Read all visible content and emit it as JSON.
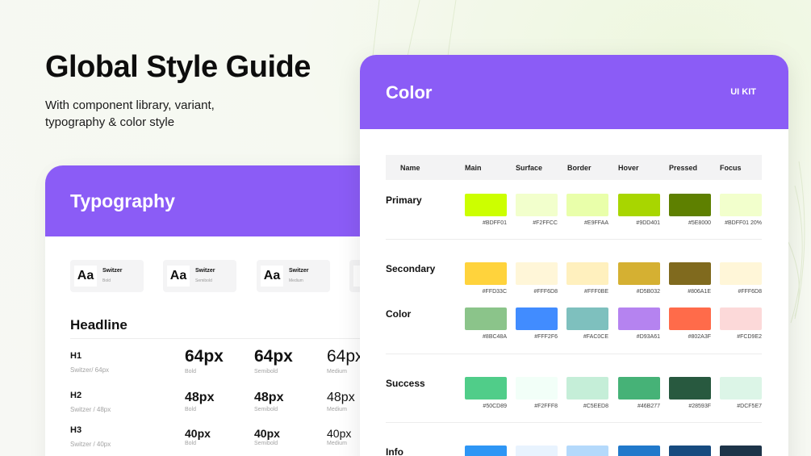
{
  "hero": {
    "title": "Global Style Guide",
    "subtitle": "With component library, variant, typography & color style"
  },
  "typography_card": {
    "title": "Typography",
    "font_chips": [
      {
        "sample": "Aa",
        "name": "Switzer",
        "weight": "Bold"
      },
      {
        "sample": "Aa",
        "name": "Switzer",
        "weight": "Semibold"
      },
      {
        "sample": "Aa",
        "name": "Switzer",
        "weight": "Medium"
      },
      {
        "sample": "A",
        "name": "",
        "weight": ""
      }
    ],
    "section_title": "Headline",
    "rows": [
      {
        "tag": "H1",
        "sub": "Switzer/ 64px",
        "size": "64px",
        "weights": [
          "Bold",
          "Semibold",
          "Medium"
        ]
      },
      {
        "tag": "H2",
        "sub": "Switzer / 48px",
        "size": "48px",
        "weights": [
          "Bold",
          "Semibold",
          "Medium"
        ]
      },
      {
        "tag": "H3",
        "sub": "Switzer / 40px",
        "size": "40px",
        "weights": [
          "Bold",
          "Semibold",
          "Medium"
        ]
      }
    ]
  },
  "color_card": {
    "title": "Color",
    "kit_label": "UI KIT",
    "accent": "#8B5CF6",
    "columns": [
      "Name",
      "Main",
      "Surface",
      "Border",
      "Hover",
      "Pressed",
      "Focus"
    ],
    "rows": [
      {
        "name": "Primary",
        "colors": [
          "#CCFF00",
          "#F2FFCC",
          "#E9FFAA",
          "#A8D600",
          "#5E8000",
          "#F2FFCC"
        ],
        "hex": [
          "#BDFF01",
          "#F2FFCC",
          "#E9FFAA",
          "#9DD401",
          "#5E8000",
          "#BDFF01 20%"
        ]
      },
      {
        "name": "Secondary",
        "colors": [
          "#FFD33C",
          "#FFF6D8",
          "#FFF0BE",
          "#D5B032",
          "#806A1E",
          "#FFF6D8"
        ],
        "hex": [
          "#FFD33C",
          "#FFF6D8",
          "#FFF0BE",
          "#D5B032",
          "#806A1E",
          "#FFF6D8"
        ]
      },
      {
        "name": "Color",
        "colors": [
          "#8BC48A",
          "#418CFF",
          "#7EC0BE",
          "#B583F0",
          "#FF6B4A",
          "#FCD9D9"
        ],
        "hex": [
          "#8BC48A",
          "#FFF2F6",
          "#FAC0CE",
          "#D93A61",
          "#802A3F",
          "#FCD9E2"
        ]
      },
      {
        "name": "Success",
        "colors": [
          "#50CD89",
          "#F2FFF8",
          "#C5EED8",
          "#46B277",
          "#28593F",
          "#DCF5E7"
        ],
        "hex": [
          "#50CD89",
          "#F2FFF8",
          "#C5EED8",
          "#46B277",
          "#28593F",
          "#DCF5E7"
        ]
      },
      {
        "name": "Info",
        "colors": [
          "#2E96F5",
          "#E8F3FE",
          "#B4D9FB",
          "#2179CB",
          "#174B7F",
          "#1D3449"
        ],
        "hex": [
          "",
          "",
          "",
          "",
          "",
          ""
        ]
      }
    ]
  }
}
